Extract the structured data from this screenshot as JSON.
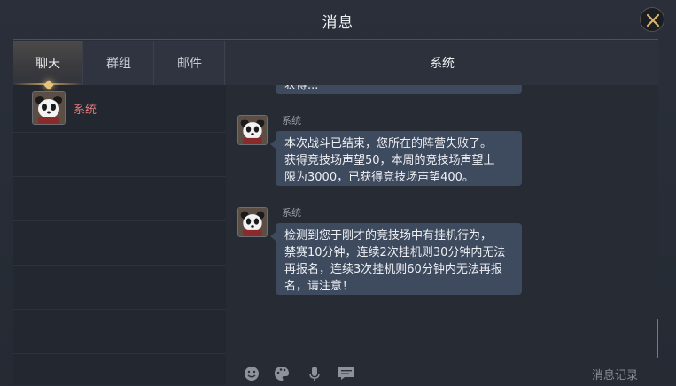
{
  "window": {
    "title": "消息"
  },
  "tabs": [
    {
      "label": "聊天",
      "active": true
    },
    {
      "label": "群组",
      "active": false
    },
    {
      "label": "邮件",
      "active": false
    }
  ],
  "contacts": [
    {
      "name": "系统",
      "icon": "panda-avatar"
    }
  ],
  "chat": {
    "header": "系统",
    "messages": [
      {
        "sender": "",
        "lines": [
          "获得..."
        ],
        "partial": true
      },
      {
        "sender": "系统",
        "lines": [
          "本次战斗已结束，您所在的阵营失败了。",
          "获得竞技场声望50，本周的竞技场声望上",
          "限为3000，已获得竞技场声望400。"
        ]
      },
      {
        "sender": "系统",
        "lines": [
          "检测到您于刚才的竞技场中有挂机行为，",
          "禁赛10分钟，连续2次挂机则30分钟内无法",
          "再报名，连续3次挂机则60分钟内无法再报",
          "名，请注意！"
        ]
      }
    ]
  },
  "toolbar": {
    "icons": [
      "emoji-icon",
      "palette-icon",
      "microphone-icon",
      "chat-bubble-icon"
    ],
    "history_label": "消息记录"
  },
  "colors": {
    "accent_gold": "#c9a35a",
    "contact_name": "#e07a7a",
    "bubble": "#3e4a5e"
  }
}
